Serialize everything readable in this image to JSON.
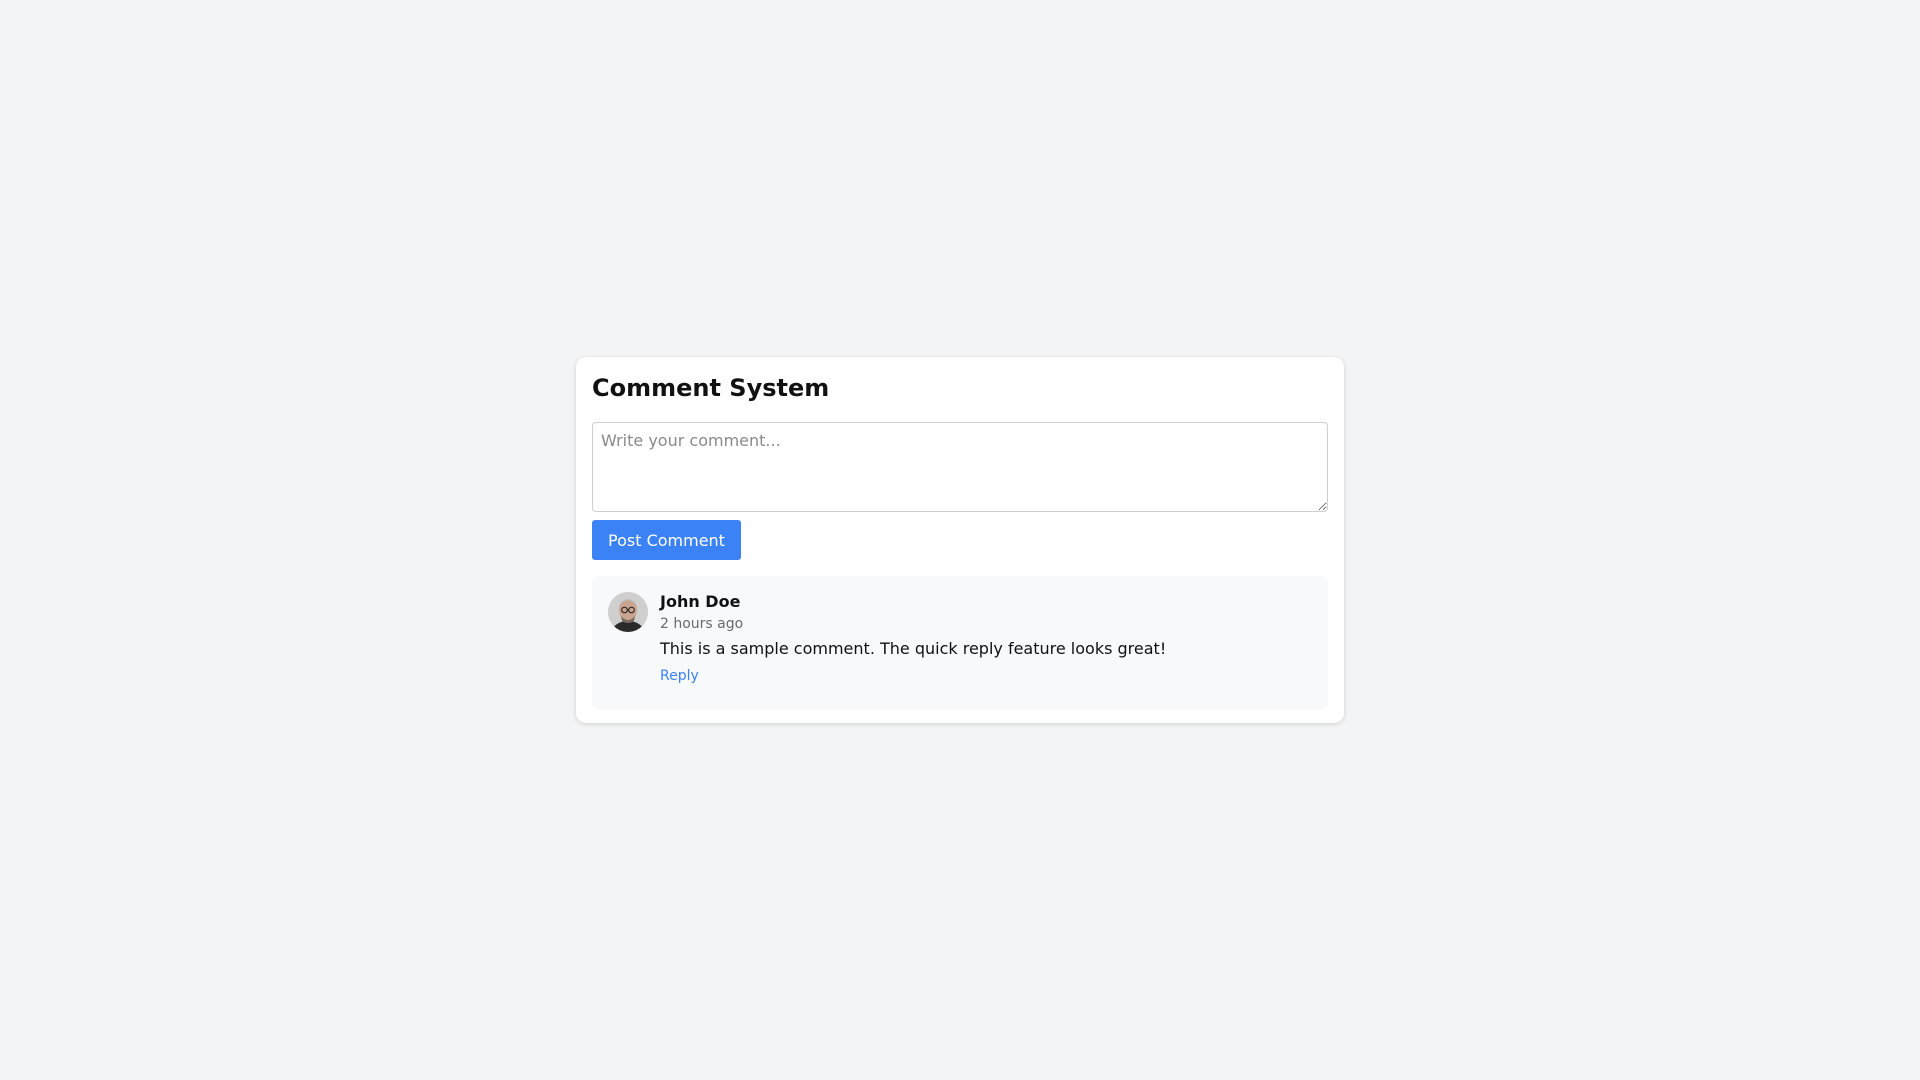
{
  "card": {
    "title": "Comment System"
  },
  "composer": {
    "placeholder": "Write your comment...",
    "value": "",
    "post_label": "Post Comment"
  },
  "comments": [
    {
      "author": "John Doe",
      "timestamp": "2 hours ago",
      "text": "This is a sample comment. The quick reply feature looks great!",
      "reply_label": "Reply",
      "avatar_icon": "user-avatar-photo"
    }
  ],
  "colors": {
    "background": "#f3f4f6",
    "card": "#ffffff",
    "accent": "#3b82f6",
    "comment_background": "#f8f9fb"
  }
}
